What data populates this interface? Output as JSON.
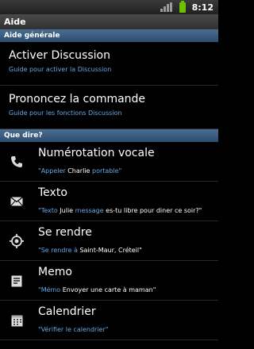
{
  "status_bar": {
    "time": "8:12"
  },
  "title": "Aide",
  "general": {
    "header": "Aide générale",
    "items": [
      {
        "title": "Activer Discussion",
        "subtitle": "Guide pour activer la Discussion"
      },
      {
        "title": "Prononcez la commande",
        "subtitle": "Guide pour les fonctions Discussion"
      }
    ]
  },
  "say": {
    "header": "Que dire?",
    "items": [
      {
        "icon": "phone-icon",
        "title": "Numérotation vocale",
        "q1": "\"",
        "k1": "Appeler",
        "m1": " Charlie ",
        "k2": "portable",
        "q2": "\""
      },
      {
        "icon": "envelope-icon",
        "title": "Texto",
        "q1": "\"",
        "k1": "Texto",
        "m1": " Julie ",
        "k2": "message",
        "q2": " es-tu libre pour diner ce soir?\""
      },
      {
        "icon": "location-icon",
        "title": "Se rendre",
        "q1": "\"",
        "k1": "Se rendre à",
        "m1": " Saint-Maur, Créteil\"",
        "k2": "",
        "q2": ""
      },
      {
        "icon": "memo-icon",
        "title": "Memo",
        "q1": "\"",
        "k1": "Mémo",
        "m1": " Envoyer une carte à maman\"",
        "k2": "",
        "q2": ""
      },
      {
        "icon": "calendar-icon",
        "title": "Calendrier",
        "q1": "\"",
        "k1": "Vérifier le calendrier",
        "m1": "\"",
        "k2": "",
        "q2": ""
      }
    ]
  },
  "colors": {
    "accent": "#69a7e6",
    "section_header": "#3a5b80",
    "battery": "#6cc000"
  }
}
